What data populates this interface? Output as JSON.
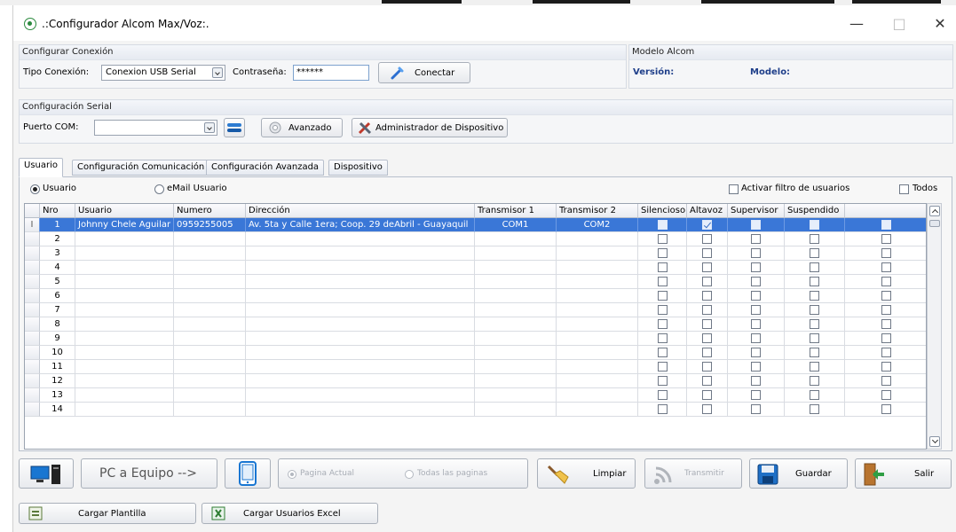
{
  "window": {
    "title": ".:Configurador Alcom Max/Voz:."
  },
  "conexion": {
    "group_title": "Configurar Conexión",
    "tipo_label": "Tipo Conexión:",
    "tipo_value": "Conexion USB Serial",
    "pass_label": "Contraseña:",
    "pass_value": "******",
    "connect_label": "Conectar"
  },
  "modelo": {
    "group_title": "Modelo Alcom",
    "version_label": "Versión:",
    "modelo_label": "Modelo:"
  },
  "serial": {
    "group_title": "Configuración Serial",
    "puerto_label": "Puerto COM:",
    "puerto_value": "",
    "avanzado_label": "Avanzado",
    "admin_label": "Administrador de Dispositivo"
  },
  "tabs": [
    "Usuario",
    "Configuración Comunicación",
    "Configuración Avanzada",
    "Dispositivo"
  ],
  "filters": {
    "usuario_radio": "Usuario",
    "email_radio": "eMail Usuario",
    "activar_filtro": "Activar filtro de usuarios",
    "todos": "Todos"
  },
  "table": {
    "columns": [
      "Nro",
      "Usuario",
      "Numero",
      "Dirección",
      "Transmisor 1",
      "Transmisor 2",
      "Silencioso",
      "Altavoz",
      "Supervisor",
      "Suspendido",
      ""
    ],
    "rows": [
      {
        "nro": "1",
        "usuario": "Johnny Chele Aguilar",
        "numero": "0959255005",
        "direccion": "Av. 5ta y Calle 1era; Coop. 29 deAbril - Guayaquil",
        "tx1": "COM1",
        "tx2": "COM2",
        "silencioso": false,
        "altavoz": true,
        "supervisor": false,
        "suspendido": false,
        "extra": false,
        "selected": true
      },
      {
        "nro": "2",
        "usuario": "",
        "numero": "",
        "direccion": "",
        "tx1": "",
        "tx2": ""
      },
      {
        "nro": "3",
        "usuario": "",
        "numero": "",
        "direccion": "",
        "tx1": "",
        "tx2": ""
      },
      {
        "nro": "4",
        "usuario": "",
        "numero": "",
        "direccion": "",
        "tx1": "",
        "tx2": ""
      },
      {
        "nro": "5",
        "usuario": "",
        "numero": "",
        "direccion": "",
        "tx1": "",
        "tx2": ""
      },
      {
        "nro": "6",
        "usuario": "",
        "numero": "",
        "direccion": "",
        "tx1": "",
        "tx2": ""
      },
      {
        "nro": "7",
        "usuario": "",
        "numero": "",
        "direccion": "",
        "tx1": "",
        "tx2": ""
      },
      {
        "nro": "8",
        "usuario": "",
        "numero": "",
        "direccion": "",
        "tx1": "",
        "tx2": ""
      },
      {
        "nro": "9",
        "usuario": "",
        "numero": "",
        "direccion": "",
        "tx1": "",
        "tx2": ""
      },
      {
        "nro": "10",
        "usuario": "",
        "numero": "",
        "direccion": "",
        "tx1": "",
        "tx2": ""
      },
      {
        "nro": "11",
        "usuario": "",
        "numero": "",
        "direccion": "",
        "tx1": "",
        "tx2": ""
      },
      {
        "nro": "12",
        "usuario": "",
        "numero": "",
        "direccion": "",
        "tx1": "",
        "tx2": ""
      },
      {
        "nro": "13",
        "usuario": "",
        "numero": "",
        "direccion": "",
        "tx1": "",
        "tx2": ""
      },
      {
        "nro": "14",
        "usuario": "",
        "numero": "",
        "direccion": "",
        "tx1": "",
        "tx2": ""
      }
    ]
  },
  "bottom": {
    "pc_equipo": "PC a Equipo -->",
    "pagina_actual": "Pagina Actual",
    "todas_paginas": "Todas las paginas",
    "limpiar": "Limpiar",
    "transmitir": "Transmitir",
    "guardar": "Guardar",
    "salir": "Salir",
    "cargar_plantilla": "Cargar Plantilla",
    "cargar_excel": "Cargar Usuarios Excel"
  },
  "icons": {
    "window": "radio-app-icon",
    "connect": "plug-icon",
    "refresh": "refresh-icon",
    "avanzado": "gear-icon",
    "admin": "tools-icon",
    "pc": "computer-icon",
    "device": "mobile-device-icon",
    "limpiar": "broom-icon",
    "transmitir": "wifi-signal-icon",
    "guardar": "floppy-disk-icon",
    "salir": "exit-door-icon",
    "plantilla": "template-icon",
    "excel": "excel-icon"
  },
  "colors": {
    "selection": "#3a77d7",
    "accent_text": "#1f3f8a"
  }
}
